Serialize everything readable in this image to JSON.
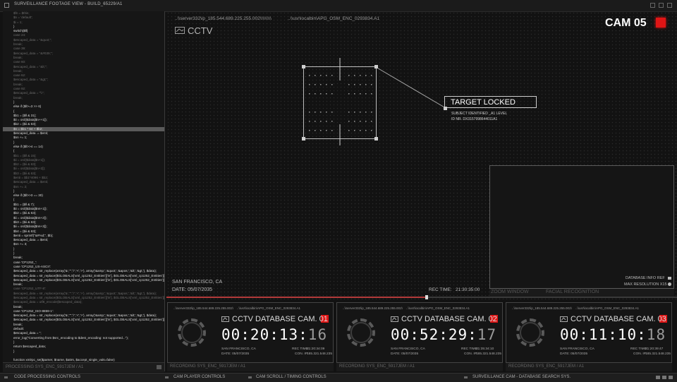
{
  "window": {
    "title": "SURVEILLANCE FOOTAGE VIEW - BUILD_65229/A1"
  },
  "code_panel": {
    "lines": [
      {
        "t": "$fn = $this;",
        "s": "dim"
      },
      {
        "t": "$n = 'default';",
        "s": "dim"
      },
      {
        "t": "$i = 1;",
        "s": "dim"
      },
      {
        "t": "}",
        "s": ""
      },
      {
        "t": "switch($ll)",
        "s": ""
      },
      {
        "t": "case 24:",
        "s": "dim"
      },
      {
        "t": "$escaped_data = \"&quot;\";",
        "s": "dim"
      },
      {
        "t": "break;",
        "s": "dim"
      },
      {
        "t": "case 39:",
        "s": "dim"
      },
      {
        "t": "$escaped_data = \"&#039;\";",
        "s": "dim"
      },
      {
        "t": "break;",
        "s": "dim"
      },
      {
        "t": "case 60:",
        "s": "dim"
      },
      {
        "t": "$escaped_data = \"&lt;\";",
        "s": "dim"
      },
      {
        "t": "break;",
        "s": "dim"
      },
      {
        "t": "case 62:",
        "s": "dim"
      },
      {
        "t": "$escaped_data = \"&gt;\";",
        "s": "dim"
      },
      {
        "t": "break;",
        "s": "dim"
      },
      {
        "t": "case 92:",
        "s": "dim"
      },
      {
        "t": "$escaped_data = \"\\\\\";",
        "s": "dim"
      },
      {
        "t": "break;",
        "s": "dim"
      },
      {
        "t": "}",
        "s": ""
      },
      {
        "t": "else if ($ll>=3 >> 6)",
        "s": ""
      },
      {
        "t": "{",
        "s": ""
      },
      {
        "t": "$b1 = ($ll & 31);",
        "s": ""
      },
      {
        "t": "$ii = ord($data[$n++1]);",
        "s": ""
      },
      {
        "t": "$b2 = ($ii & 63);",
        "s": ""
      },
      {
        "t": "$n = $b1 * 64 + $b2;",
        "s": "sel"
      },
      {
        "t": "$escaped_data .= $enti;",
        "s": ""
      },
      {
        "t": "$nn += 1;",
        "s": ""
      },
      {
        "t": "}",
        "s": ""
      },
      {
        "t": "else if ($ll>>4 == 14)",
        "s": ""
      },
      {
        "t": "{",
        "s": ""
      },
      {
        "t": "$b1 = ($ll & 15);",
        "s": "dim"
      },
      {
        "t": "$ii = ord($data[$n+1]);",
        "s": "dim"
      },
      {
        "t": "$b2 = ($ii & 63);",
        "s": "dim"
      },
      {
        "t": "$ii = ord($data[$n+2]);",
        "s": "dim"
      },
      {
        "t": "$b3 = ($ii & 63);",
        "s": "dim"
      },
      {
        "t": "$enti = $b1*4096 + $b2;",
        "s": "dim"
      },
      {
        "t": "$escaped_data .= $enti;",
        "s": "dim"
      },
      {
        "t": "$nn += 2;",
        "s": "dim"
      },
      {
        "t": "}",
        "s": ""
      },
      {
        "t": "else if ($ll>>3 == 30)",
        "s": ""
      },
      {
        "t": "{",
        "s": ""
      },
      {
        "t": "$b1 = ($ll & 7);",
        "s": ""
      },
      {
        "t": "$ii = ord($data[$nn+1]);",
        "s": ""
      },
      {
        "t": "$b2 = ($ii & 63);",
        "s": ""
      },
      {
        "t": "$ii = ord($data[$nn+2]);",
        "s": ""
      },
      {
        "t": "$b3 = ($ii & 63);",
        "s": ""
      },
      {
        "t": "$ii = ord($data[$nn+3]);",
        "s": ""
      },
      {
        "t": "$b4 = ($ii & 63);",
        "s": ""
      },
      {
        "t": "$enti = sprintf(\"&#%d;\", $b);",
        "s": ""
      },
      {
        "t": "$escaped_data .= $enti;",
        "s": ""
      },
      {
        "t": "$nn += 3;",
        "s": ""
      },
      {
        "t": "}",
        "s": ""
      },
      {
        "t": "}",
        "s": ""
      },
      {
        "t": "break;",
        "s": ""
      },
      {
        "t": "case 'CP1252_':",
        "s": ""
      },
      {
        "t": "case 'CP1252_US-ASCII':",
        "s": ""
      },
      {
        "t": "$escaped_data = str_replace(array('&','\"','\\'','<','>'), array('&amp;','&quot;','&apos;','&lt;','&gt;'), $data);",
        "s": ""
      },
      {
        "t": "$escaped_data = str_replace($GLOBALS['xml_cp1252_Entities']['in'], $GLOBALS['xml_cp1252_Entities']['out'], $escaped_da",
        "s": ""
      },
      {
        "t": "$escaped_data = str_replace($GLOBALS['xml_cp1252_Entities']['in'], $GLOBALS['xml_cp1252_Entities']['out'], $escaped",
        "s": ""
      },
      {
        "t": "break;",
        "s": ""
      },
      {
        "t": "case 'CP1252_UTF-8':",
        "s": "dim"
      },
      {
        "t": "$escaped_data = str_replace(array('&','\"','\\'','<','>'), array('&amp;','&quot;','&apos;','&lt;','&gt;'), $data);",
        "s": "dim"
      },
      {
        "t": "$escaped_data = str_replace($GLOBALS['xml_cp1252_Entities']['in'], $GLOBALS['xml_cp1252_Entities']['out'], $escap",
        "s": "dim"
      },
      {
        "t": "$escaped_data = utf8_encode($escaped_data);",
        "s": "dim"
      },
      {
        "t": "break;",
        "s": ""
      },
      {
        "t": "case 'CP1252_ISO-8859-1':",
        "s": ""
      },
      {
        "t": "$escaped_data = str_replace(array('&','\"','\\'','<','>'), array('&amp;','&quot;','&apos;','&lt;','&gt;'), $data);",
        "s": ""
      },
      {
        "t": "$escaped_data = str_replace($GLOBALS['xml_cp1252_Entities']['in'], $GLOBALS['xml_cp1252_Entities']['out'], $escaped",
        "s": ""
      },
      {
        "t": "break;",
        "s": ""
      },
      {
        "t": "default:",
        "s": ""
      },
      {
        "t": "$escaped_data = '';",
        "s": ""
      },
      {
        "t": "error_log(\"Converting from $src_encoding to $dest_encoding: not supported...\");",
        "s": ""
      },
      {
        "t": "}",
        "s": ""
      },
      {
        "t": "return $escaped_data;",
        "s": ""
      },
      {
        "t": "}",
        "s": ""
      },
      {
        "t": "",
        "s": ""
      },
      {
        "t": "function xmlrpc_se($parser, $name, $attrs, $accept_single_vals=false)",
        "s": ""
      },
      {
        "t": "{",
        "s": ""
      },
      {
        "t": "if ($GLOBALS['_xh']['ac'] = '')",
        "s": ""
      },
      {
        "t": "{",
        "s": ""
      },
      {
        "t": "if (count($GLOBALS['_xh']['stack']) == 0)",
        "s": ""
      }
    ],
    "footer": "PROCESSING SYS_ENC_5917JEM / A1"
  },
  "main_view": {
    "logo": "CCTV",
    "path_left": "..\\\\server332\\ip_185.544.689.225.255.002\\\\\\\\\\\\\\\\\\",
    "path_right": "..\\\\usr\\localbin\\APG_OSM_ENC_0293834.A1",
    "cam_label": "CAM 05",
    "target": {
      "title": "TARGET LOCKED",
      "line1": "SUBJECT IDENTIFIED _A1 LEVEL",
      "line2": "ID NR. DX3157998644011A1"
    },
    "location": "SAN FRANCISCO, CA",
    "date": "DATE: 05/07/2035",
    "rec_label": "REC TIME:",
    "rec_time": "21:30:35:00",
    "playback_progress": 0.51,
    "zoom_panel": {
      "info1": "DATABASE INFO REF",
      "info2": "MAX RESOLUTION X15",
      "tab_zoom": "ZOOM WINDOW",
      "tab_facial": "FACIAL RECOGNITION"
    }
  },
  "cams": [
    {
      "path_left": "..\\\\server332\\ip_185.544.689.225.255.002\\",
      "path_right": "..\\\\usr\\localbin\\APG_OSM_ENC_0293834.A1",
      "title": "CCTV DATABASE CAM. 01",
      "time_main": "00:20:13:",
      "time_frac": "16",
      "location": "SAN FRANCISCO, CA",
      "date": "DATE: 05/07/2035",
      "rec_label": "REC TIME:",
      "rec_value": "21:20:34:09",
      "con_label": "CON. IP:",
      "con_value": "185.321.548.235",
      "footer": "RECORDING SYS_ENC_5917JEM / A1"
    },
    {
      "path_left": "..\\\\server332\\ip_185.544.689.225.255.002\\",
      "path_right": "..\\\\usr\\localbin\\APG_OSM_ENC_0293834.A1",
      "title": "CCTV DATABASE CAM. 02",
      "time_main": "00:52:29:",
      "time_frac": "17",
      "location": "SAN FRANCISCO, CA",
      "date": "DATE: 05/07/2035",
      "rec_label": "REC TIME:",
      "rec_value": "21:35:34:10",
      "con_label": "CON. IP:",
      "con_value": "185.321.548.235",
      "footer": "RECORDING SYS_ENC_5917JEM / A1"
    },
    {
      "path_left": "..\\\\server332\\ip_185.544.689.225.255.002\\",
      "path_right": "..\\\\usr\\localbin\\APG_OSM_ENC_0293834.A1",
      "title": "CCTV DATABASE CAM. 03",
      "time_main": "00:11:10:",
      "time_frac": "18",
      "location": "SAN FRANCISCO, CA",
      "date": "DATE: 05/07/2035",
      "rec_label": "REC TIME:",
      "rec_value": "21:20:39:47",
      "con_label": "CON. IP:",
      "con_value": "185.321.548.235",
      "footer": "RECORDING SYS_ENC_5917JEM / A1"
    }
  ],
  "nav": {
    "items": [
      "CODE PROCESSING CONTROLS",
      "CAM PLAYER CONTROLS",
      "CAM SCROLL / TIMING CONTROLS",
      "SURVEILLANCE CAM - DATABASE SEARCH SYS."
    ]
  },
  "colors": {
    "rec_red": "#e01515",
    "accent": "#ffffff",
    "background": "#121212"
  },
  "icons": [
    "cctv-camera-icon",
    "record-indicator-icon",
    "window-close-icon",
    "window-minimize-icon"
  ]
}
